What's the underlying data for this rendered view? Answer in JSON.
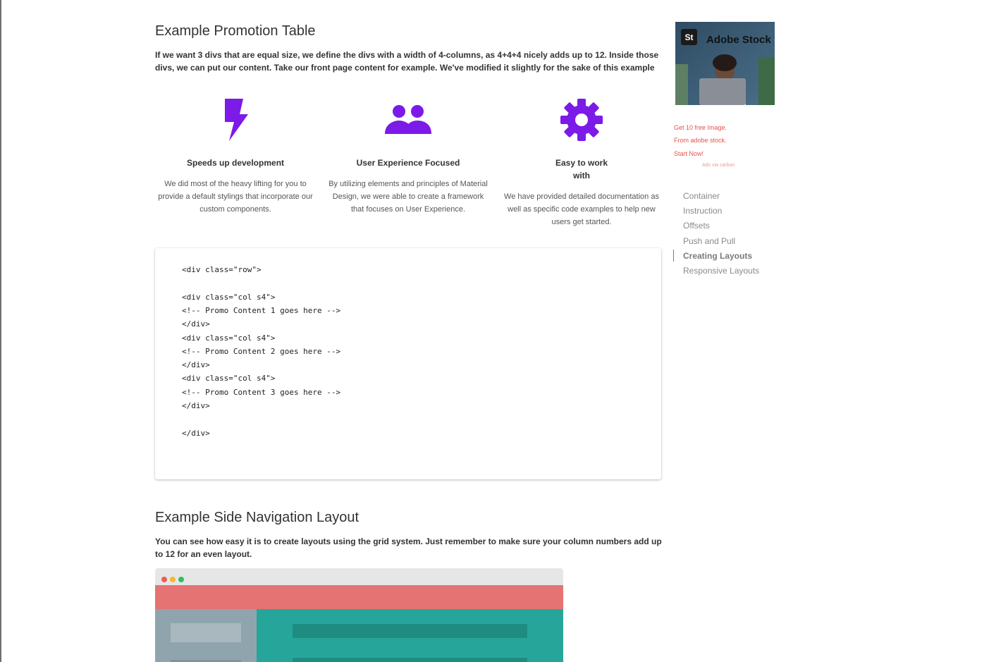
{
  "colors": {
    "accent_purple": "#7c1ae8",
    "ad_text": "#e5534b",
    "mock_red": "#e57373",
    "mock_teal": "#26a69a",
    "mock_teal_dark": "#1f8c81",
    "mock_grey": "#90a4ae",
    "mock_grey_light": "#a9b8bf"
  },
  "promotion": {
    "title": "Example Promotion Table",
    "lead": "If we want 3 divs that are equal size, we define the divs with a width of 4-columns, as 4+4+4 nicely adds up to 12. Inside those divs, we can put our content. Take our front page content for example. We've modified it slightly for the sake of this example",
    "items": [
      {
        "icon": "flash-icon",
        "title": "Speeds up development",
        "text": "We did most of the heavy lifting for you to provide a default stylings that incorporate our custom components."
      },
      {
        "icon": "group-icon",
        "title": "User Experience Focused",
        "text": "By utilizing elements and principles of Material Design, we were able to create a framework that focuses on User Experience."
      },
      {
        "icon": "settings-icon",
        "title": "Easy to work with",
        "text": "We have provided detailed documentation as well as specific code examples to help new users get started."
      }
    ],
    "code_lines": [
      "<div class=\"row\">",
      "",
      "<div class=\"col s4\">",
      "<!-- Promo Content 1 goes here -->",
      "</div>",
      "<div class=\"col s4\">",
      "<!-- Promo Content 2 goes here -->",
      "</div>",
      "<div class=\"col s4\">",
      "<!-- Promo Content 3 goes here -->",
      "</div>",
      "",
      "</div>"
    ]
  },
  "side_nav_section": {
    "title": "Example Side Navigation Layout",
    "lead": "You can see how easy it is to create layouts using the grid system. Just remember to make sure your column numbers add up to 12 for an even layout."
  },
  "ad": {
    "brand": "Adobe Stock",
    "brand_mark": "St",
    "line1": "Get 10 free Image.",
    "line2": "From adobe stock.",
    "line3": "Start Now!",
    "via": "Ads via carbon"
  },
  "toc": {
    "items": [
      {
        "label": "Container",
        "active": false
      },
      {
        "label": "Instruction",
        "active": false
      },
      {
        "label": "Offsets",
        "active": false
      },
      {
        "label": "Push and Pull",
        "active": false
      },
      {
        "label": "Creating Layouts",
        "active": true
      },
      {
        "label": "Responsive Layouts",
        "active": false
      }
    ]
  }
}
